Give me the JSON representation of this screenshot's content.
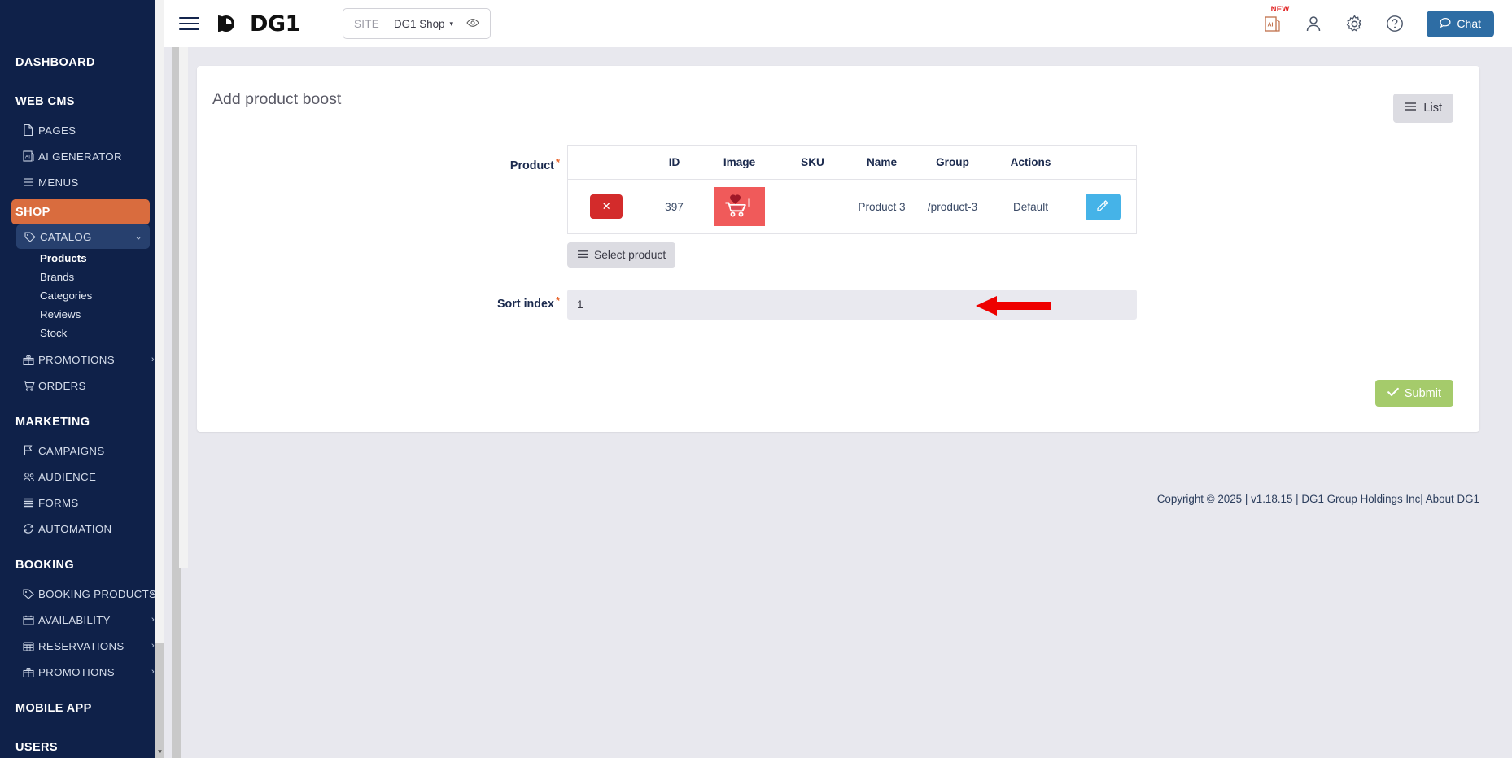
{
  "header": {
    "menu_icon": "hamburger-menu-icon",
    "logo_text": "DG1",
    "site_label": "SITE",
    "site_value": "DG1 Shop",
    "site_caret": "▾",
    "eye_icon": "eye-preview-icon",
    "ai_icon": "ai-document-icon",
    "ai_badge": "NEW",
    "user_icon": "user-account-icon",
    "gear_icon": "settings-gear-icon",
    "help_icon": "help-question-icon",
    "chat_label": "Chat",
    "chat_icon": "chat-bubble-icon"
  },
  "sidebar": {
    "sections": [
      {
        "type": "section",
        "label": "DASHBOARD"
      },
      {
        "type": "section",
        "label": "WEB CMS"
      },
      {
        "type": "item",
        "label": "PAGES",
        "icon": "page-file-icon"
      },
      {
        "type": "item",
        "label": "AI GENERATOR",
        "icon": "ai-generator-icon"
      },
      {
        "type": "item",
        "label": "MENUS",
        "icon": "menu-lines-icon"
      },
      {
        "type": "shop",
        "label": "SHOP"
      },
      {
        "type": "expanded",
        "label": "CATALOG",
        "icon": "tag-icon",
        "chevron": "⌄"
      },
      {
        "type": "leaf",
        "label": "Products",
        "active": true
      },
      {
        "type": "leaf",
        "label": "Brands",
        "active": false
      },
      {
        "type": "leaf",
        "label": "Categories",
        "active": false
      },
      {
        "type": "leaf",
        "label": "Reviews",
        "active": false
      },
      {
        "type": "leaf",
        "label": "Stock",
        "active": false
      },
      {
        "type": "item",
        "label": "PROMOTIONS",
        "icon": "gift-icon",
        "chevron": "›"
      },
      {
        "type": "item",
        "label": "ORDERS",
        "icon": "cart-icon"
      },
      {
        "type": "section",
        "label": "MARKETING"
      },
      {
        "type": "item",
        "label": "CAMPAIGNS",
        "icon": "flag-icon"
      },
      {
        "type": "item",
        "label": "AUDIENCE",
        "icon": "people-icon"
      },
      {
        "type": "item",
        "label": "FORMS",
        "icon": "forms-lines-icon"
      },
      {
        "type": "item",
        "label": "AUTOMATION",
        "icon": "refresh-automation-icon"
      },
      {
        "type": "section",
        "label": "BOOKING"
      },
      {
        "type": "item",
        "label": "BOOKING PRODUCTS",
        "icon": "tag-icon",
        "chevron": "›"
      },
      {
        "type": "item",
        "label": "AVAILABILITY",
        "icon": "calendar-icon",
        "chevron": "›"
      },
      {
        "type": "item",
        "label": "RESERVATIONS",
        "icon": "grid-calendar-icon",
        "chevron": "›"
      },
      {
        "type": "item",
        "label": "PROMOTIONS",
        "icon": "gift-icon",
        "chevron": "›"
      },
      {
        "type": "section",
        "label": "MOBILE APP"
      },
      {
        "type": "section",
        "label": "USERS"
      }
    ]
  },
  "page": {
    "title": "Add product boost",
    "list_button": "List",
    "list_icon": "list-lines-icon",
    "submit_button": "Submit",
    "submit_icon": "check-icon"
  },
  "form": {
    "product_label": "Product",
    "required_mark": "*",
    "select_product_button": "Select product",
    "select_product_icon": "list-lines-icon",
    "sort_index_label": "Sort index",
    "sort_index_value": "1",
    "table": {
      "columns": [
        "",
        "ID",
        "Image",
        "SKU",
        "Name",
        "Group",
        "Actions",
        ""
      ],
      "rows": [
        {
          "delete_icon": "✕",
          "id": "397",
          "image_alt": "product-thumbnail-cart-heart",
          "sku": "",
          "name": "Product 3",
          "group": "/product-3",
          "actions": "Default",
          "edit_icon": "edit-pencil-icon"
        }
      ]
    }
  },
  "annotation": {
    "arrow": "red-left-arrow-pointing-to-sort-index",
    "color": "#ee0000"
  },
  "footer": {
    "copyright": "Copyright © 2025",
    "sep1": "|",
    "version": "v1.18.15",
    "sep2": "|",
    "company": "DG1 Group Holdings Inc",
    "sep3": "|",
    "about": "About DG1"
  },
  "colors": {
    "sidebar_bg": "#0f2149",
    "shop_highlight": "#d96c3e",
    "catalog_highlight": "#27406e",
    "chat_blue": "#2e6da4",
    "submit_green": "#a5cb6b",
    "delete_red": "#d32b2b",
    "edit_blue": "#45b3e8",
    "thumb_red": "#f05a5a",
    "page_bg": "#e8e8ee"
  }
}
